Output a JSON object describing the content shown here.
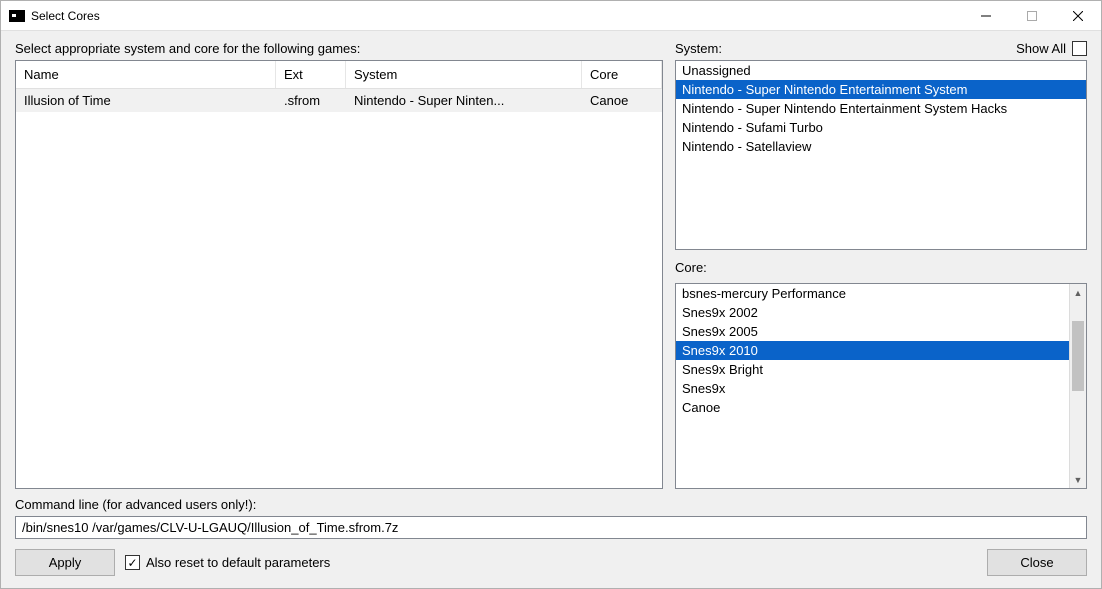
{
  "window": {
    "title": "Select Cores"
  },
  "labels": {
    "instruction": "Select appropriate system and core for the following games:",
    "system": "System:",
    "core": "Core:",
    "show_all": "Show All",
    "command_line": "Command line (for advanced users only!):",
    "reset_defaults": "Also reset to default parameters"
  },
  "buttons": {
    "apply": "Apply",
    "close": "Close"
  },
  "games_table": {
    "headers": {
      "name": "Name",
      "ext": "Ext",
      "system": "System",
      "core": "Core"
    },
    "rows": [
      {
        "name": "Illusion of Time",
        "ext": ".sfrom",
        "system": "Nintendo - Super Ninten...",
        "core": "Canoe",
        "selected": true
      }
    ]
  },
  "system_list": {
    "items": [
      {
        "label": "Unassigned",
        "selected": false
      },
      {
        "label": "Nintendo - Super Nintendo Entertainment System",
        "selected": true
      },
      {
        "label": "Nintendo - Super Nintendo Entertainment System Hacks",
        "selected": false
      },
      {
        "label": "Nintendo - Sufami Turbo",
        "selected": false
      },
      {
        "label": "Nintendo - Satellaview",
        "selected": false
      }
    ]
  },
  "core_list": {
    "items": [
      {
        "label": "bsnes-mercury Performance",
        "selected": false
      },
      {
        "label": "Snes9x 2002",
        "selected": false
      },
      {
        "label": "Snes9x 2005",
        "selected": false
      },
      {
        "label": "Snes9x 2010",
        "selected": true
      },
      {
        "label": "Snes9x Bright",
        "selected": false
      },
      {
        "label": "Snes9x",
        "selected": false
      },
      {
        "label": "Canoe",
        "selected": false
      }
    ]
  },
  "show_all_checked": false,
  "reset_checked": true,
  "command_line_value": "/bin/snes10 /var/games/CLV-U-LGAUQ/Illusion_of_Time.sfrom.7z"
}
